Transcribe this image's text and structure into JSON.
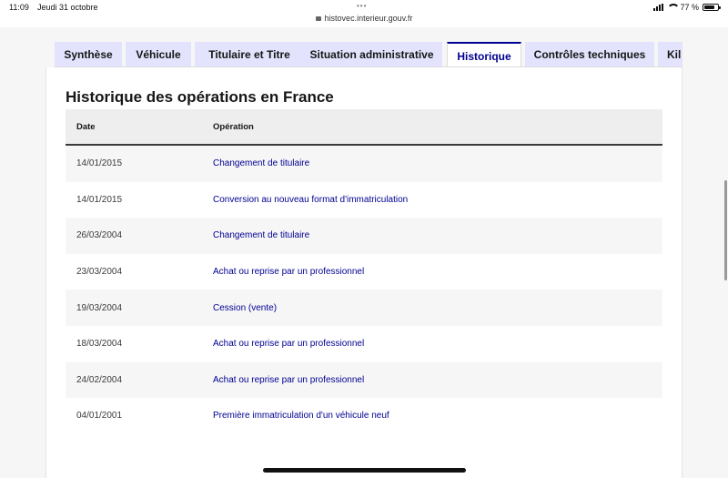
{
  "status_bar": {
    "time": "11:09",
    "date": "Jeudi 31 octobre",
    "url": "histovec.interieur.gouv.fr",
    "battery": "77 %",
    "battery_level": 0.77
  },
  "tabs": [
    {
      "label": "Synthèse",
      "active": false
    },
    {
      "label": "Véhicule",
      "active": false
    },
    {
      "label": "Titulaire et Titre",
      "active": false
    },
    {
      "label": "Situation administrative",
      "active": false
    },
    {
      "label": "Historique",
      "active": true
    },
    {
      "label": "Contrôles techniques",
      "active": false
    },
    {
      "label": "Kil",
      "active": false
    }
  ],
  "page_title": "Historique des opérations en France",
  "table": {
    "headers": {
      "date": "Date",
      "operation": "Opération"
    },
    "rows": [
      {
        "date": "14/01/2015",
        "operation": "Changement de titulaire"
      },
      {
        "date": "14/01/2015",
        "operation": "Conversion au nouveau format d'immatriculation"
      },
      {
        "date": "26/03/2004",
        "operation": "Changement de titulaire"
      },
      {
        "date": "23/03/2004",
        "operation": "Achat ou reprise par un professionnel"
      },
      {
        "date": "19/03/2004",
        "operation": "Cession (vente)"
      },
      {
        "date": "18/03/2004",
        "operation": "Achat ou reprise par un professionnel"
      },
      {
        "date": "24/02/2004",
        "operation": "Achat ou reprise par un professionnel"
      },
      {
        "date": "04/01/2001",
        "operation": "Première immatriculation d'un véhicule neuf"
      }
    ]
  },
  "colors": {
    "accent": "#000091",
    "tab_bg": "#e3e3fd"
  }
}
